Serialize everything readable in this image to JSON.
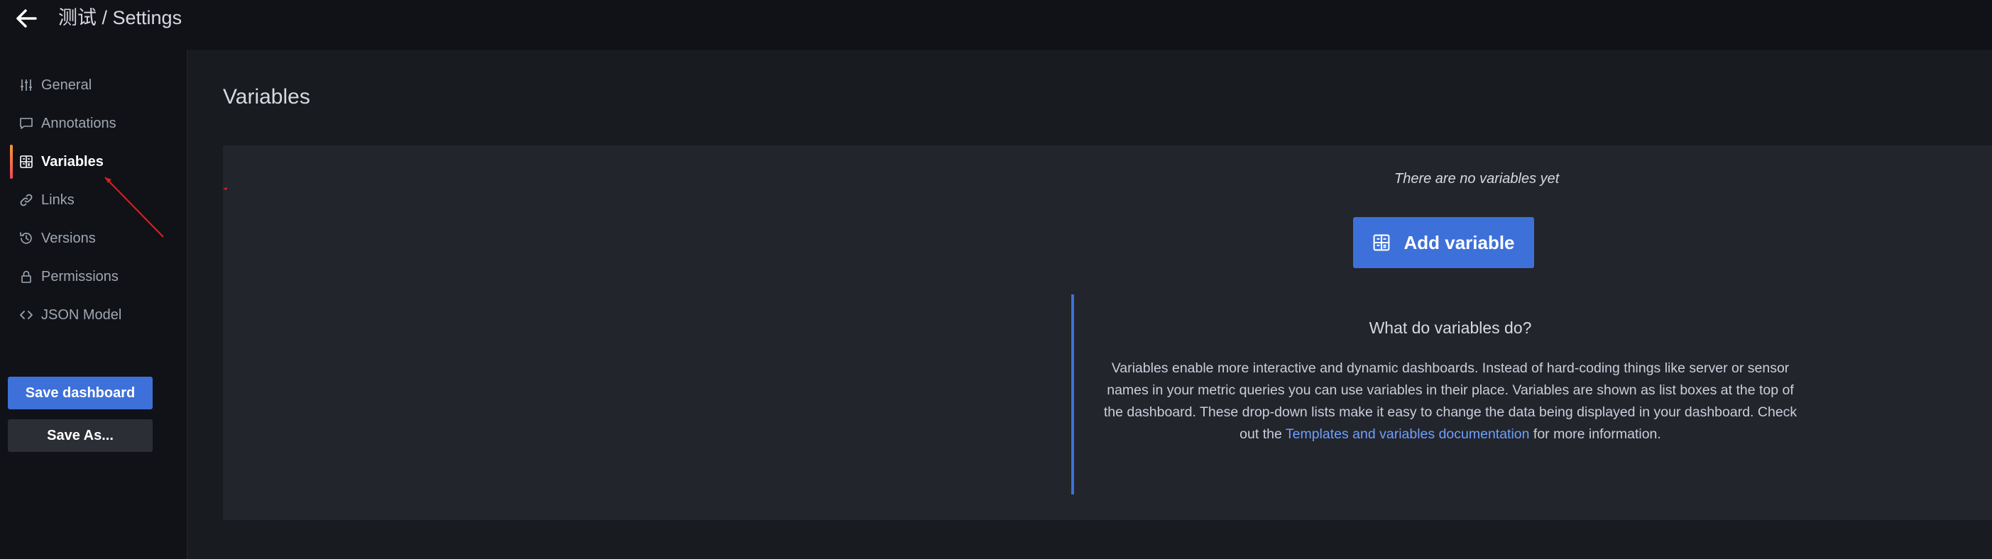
{
  "header": {
    "title": "测试 / Settings"
  },
  "sidebar": {
    "items": [
      {
        "label": "General",
        "icon": "sliders-icon"
      },
      {
        "label": "Annotations",
        "icon": "comment-icon"
      },
      {
        "label": "Variables",
        "icon": "calculator-icon",
        "active": true
      },
      {
        "label": "Links",
        "icon": "link-icon"
      },
      {
        "label": "Versions",
        "icon": "history-icon"
      },
      {
        "label": "Permissions",
        "icon": "lock-icon"
      },
      {
        "label": "JSON Model",
        "icon": "code-icon"
      }
    ],
    "save_label": "Save dashboard",
    "save_as_label": "Save As..."
  },
  "main": {
    "title": "Variables",
    "empty_state": {
      "title": "There are no variables yet",
      "button_label": "Add variable",
      "callout_title": "What do variables do?",
      "callout_text_before": "Variables enable more interactive and dynamic dashboards. Instead of hard-coding things like server or sensor names in your metric queries you can use variables in their place. Variables are shown as list boxes at the top of the dashboard. These drop-down lists make it easy to change the data being displayed in your dashboard. Check out the ",
      "callout_link": "Templates and variables documentation",
      "callout_text_after": " for more information."
    }
  },
  "colors": {
    "background": "#111217",
    "panel": "#22252b",
    "primary": "#3d71d9",
    "link": "#6e9fff",
    "annotation": "#e02020"
  }
}
